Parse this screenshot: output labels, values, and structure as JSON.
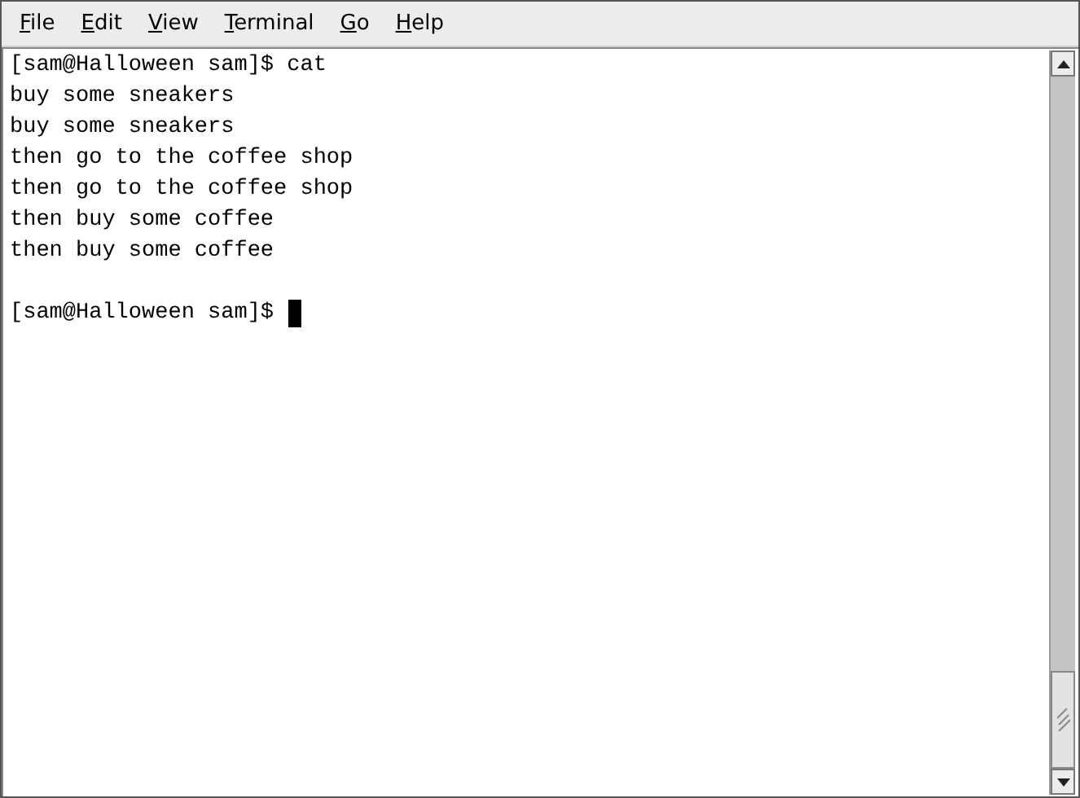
{
  "menu": [
    {
      "label": "File"
    },
    {
      "label": "Edit"
    },
    {
      "label": "View"
    },
    {
      "label": "Terminal"
    },
    {
      "label": "Go"
    },
    {
      "label": "Help"
    }
  ],
  "terminal": {
    "lines": [
      "[sam@Halloween sam]$ cat",
      "buy some sneakers",
      "buy some sneakers",
      "then go to the coffee shop",
      "then go to the coffee shop",
      "then buy some coffee",
      "then buy some coffee"
    ],
    "prompt": "[sam@Halloween sam]$"
  }
}
